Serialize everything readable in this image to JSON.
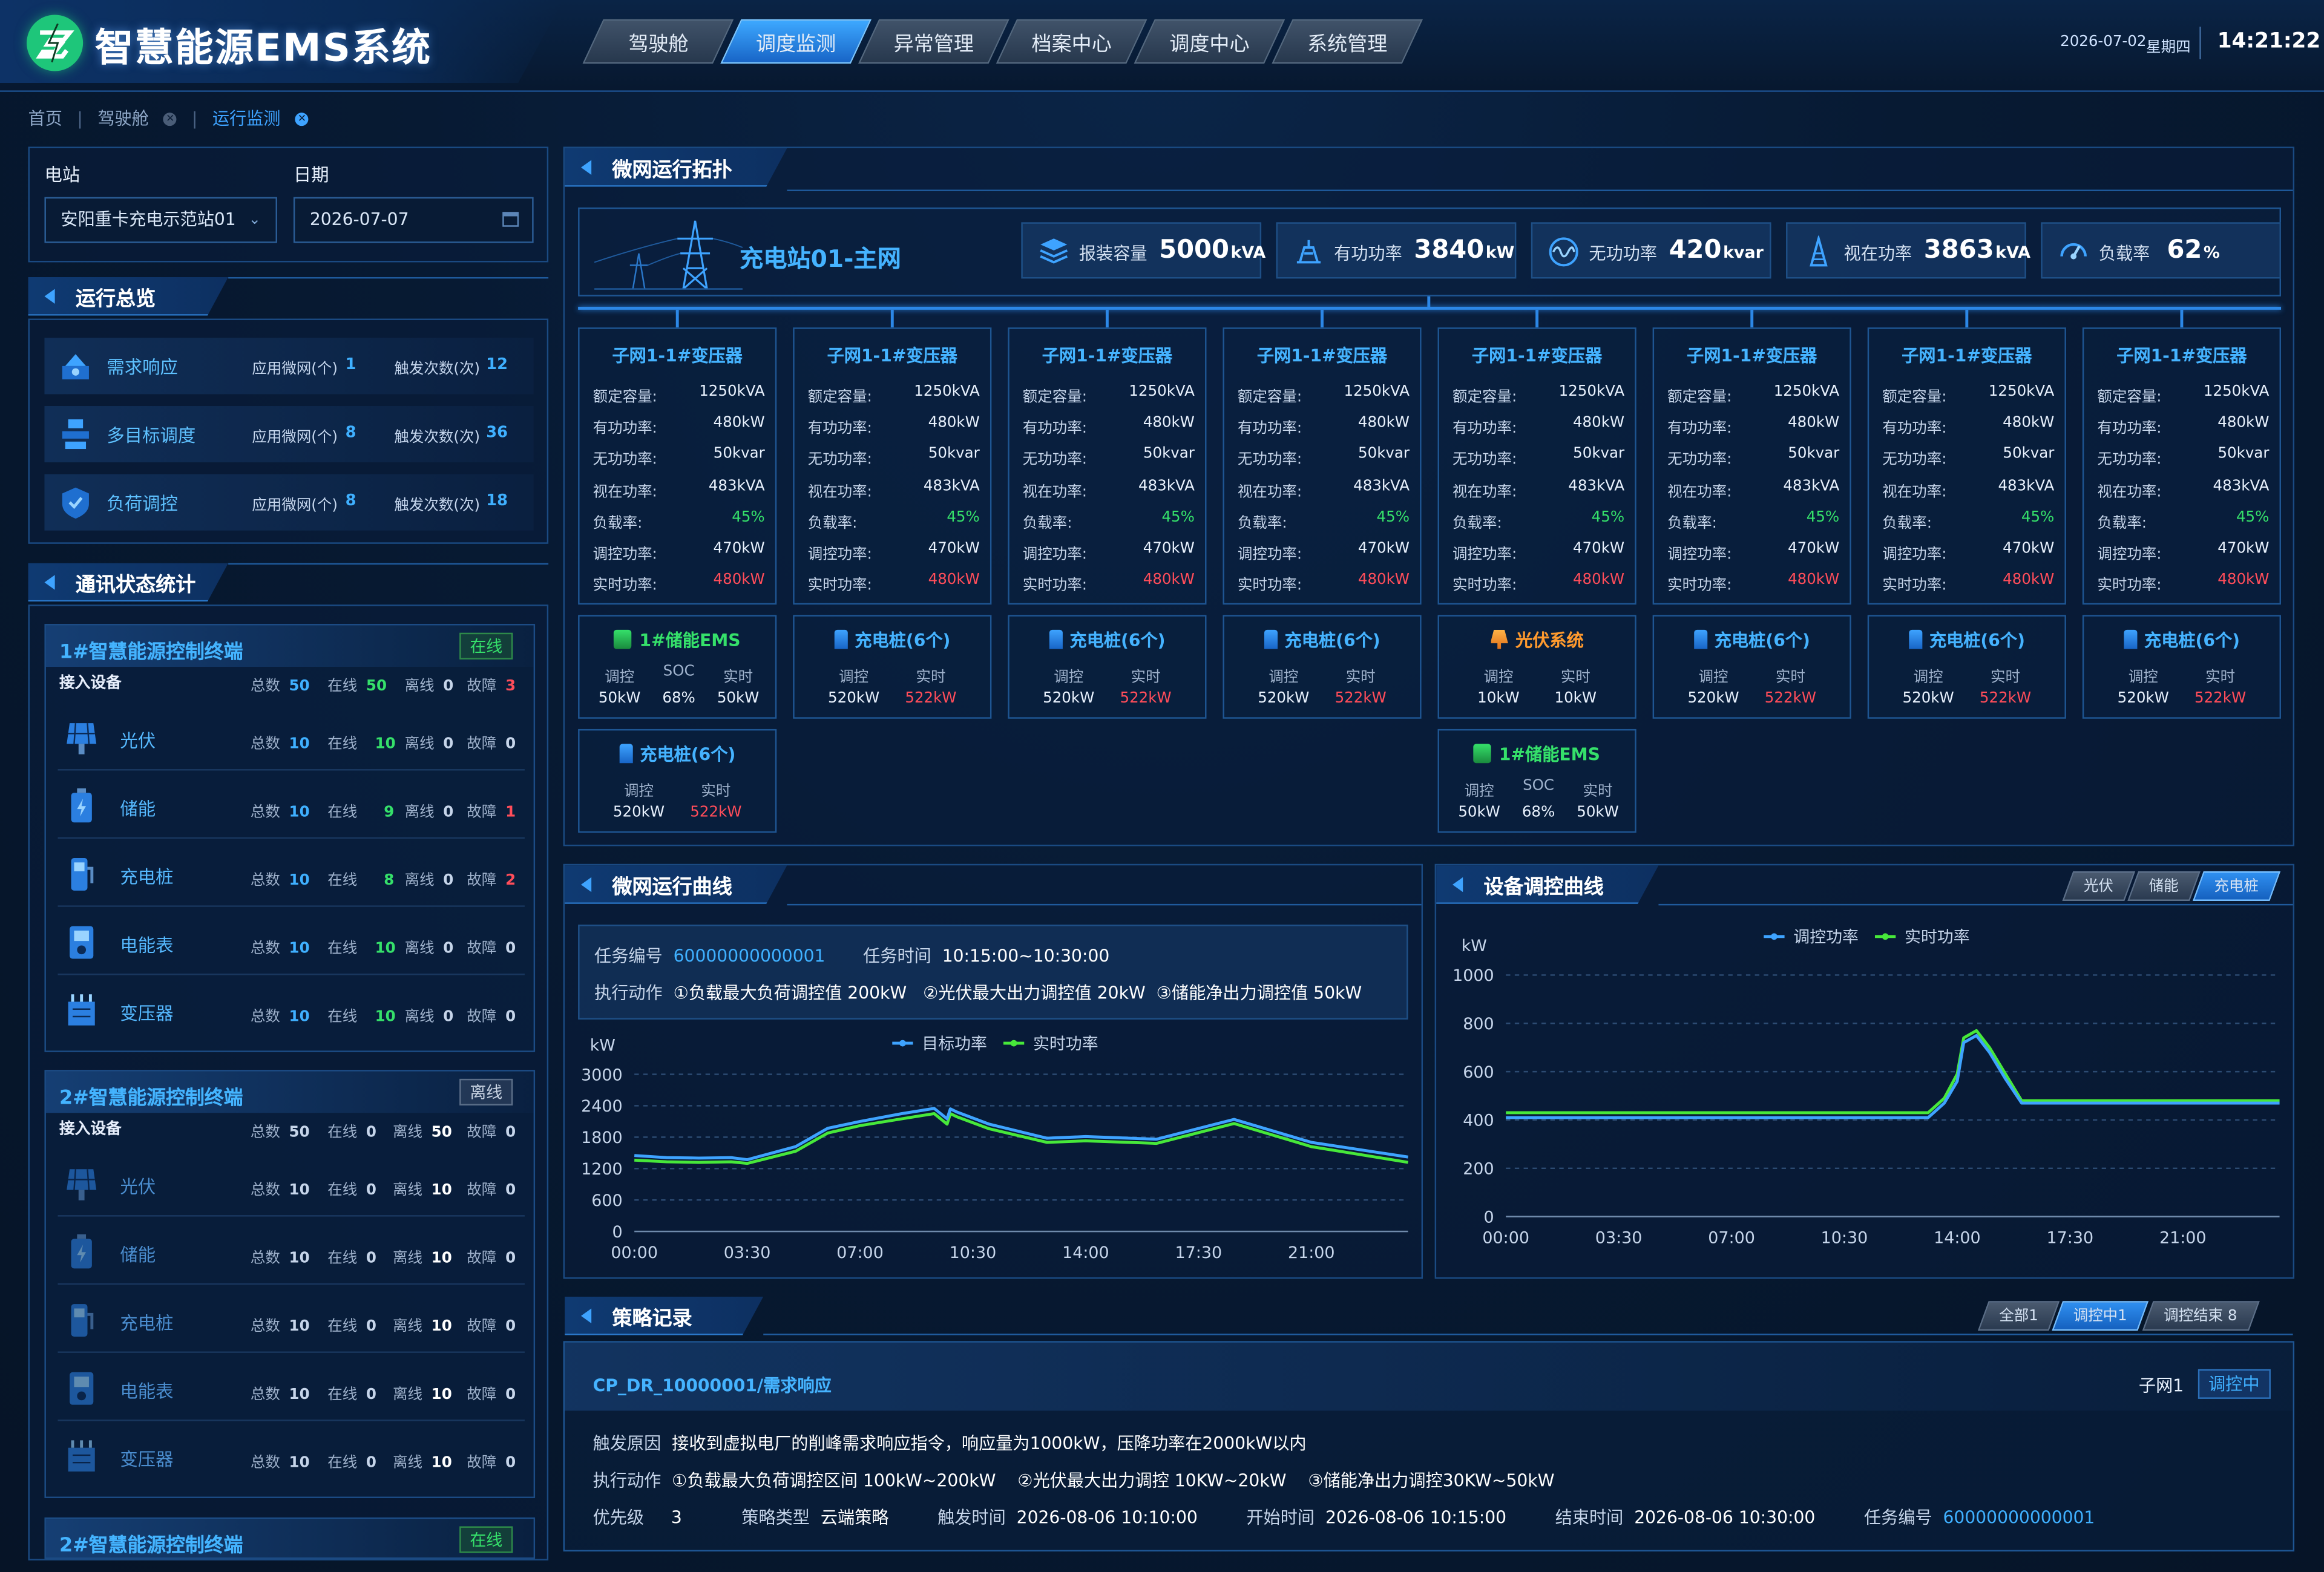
{
  "header": {
    "title": "智慧能源EMS系统",
    "nav": [
      "驾驶舱",
      "调度监测",
      "异常管理",
      "档案中心",
      "调度中心",
      "系统管理"
    ],
    "active_nav": "调度监测",
    "date": "2026-07-02",
    "weekday": "星期四",
    "time": "14:21:22"
  },
  "breadcrumb": [
    "首页",
    "驾驶舱",
    "运行监测"
  ],
  "filter": {
    "station_label": "电站",
    "station_value": "安阳重卡充电示范站01",
    "date_label": "日期",
    "date_value": "2026-07-07"
  },
  "overview": {
    "title": "运行总览",
    "col1_label": "应用微网(个)",
    "col2_label": "触发次数(次)",
    "items": [
      {
        "name": "需求响应",
        "grids": "1",
        "triggers": "12",
        "icon": "demand-response-icon"
      },
      {
        "name": "多目标调度",
        "grids": "8",
        "triggers": "36",
        "icon": "multi-objective-icon"
      },
      {
        "name": "负荷调控",
        "grids": "8",
        "triggers": "18",
        "icon": "load-control-icon"
      }
    ]
  },
  "comm": {
    "title": "通讯状态统计",
    "labels": {
      "total": "总数",
      "online": "在线",
      "offline": "离线",
      "fault": "故障",
      "access": "接入设备"
    },
    "terminals": [
      {
        "name": "1#智慧能源控制终端",
        "status": "在线",
        "summary": {
          "total": "50",
          "online": "50",
          "offline": "0",
          "fault": "3"
        },
        "devices": [
          {
            "name": "光伏",
            "total": "10",
            "online": "10",
            "offline": "0",
            "fault": "0",
            "icon": "solar-panel-icon"
          },
          {
            "name": "储能",
            "total": "10",
            "online": "9",
            "offline": "0",
            "fault": "1",
            "icon": "battery-icon"
          },
          {
            "name": "充电桩",
            "total": "10",
            "online": "8",
            "offline": "0",
            "fault": "2",
            "icon": "charger-icon"
          },
          {
            "name": "电能表",
            "total": "10",
            "online": "10",
            "offline": "0",
            "fault": "0",
            "icon": "meter-icon"
          },
          {
            "name": "变压器",
            "total": "10",
            "online": "10",
            "offline": "0",
            "fault": "0",
            "icon": "transformer-icon"
          }
        ]
      },
      {
        "name": "2#智慧能源控制终端",
        "status": "离线",
        "summary": {
          "total": "50",
          "online": "0",
          "offline": "50",
          "fault": "0"
        },
        "devices": [
          {
            "name": "光伏",
            "total": "10",
            "online": "0",
            "offline": "10",
            "fault": "0",
            "icon": "solar-panel-icon"
          },
          {
            "name": "储能",
            "total": "10",
            "online": "0",
            "offline": "10",
            "fault": "0",
            "icon": "battery-icon"
          },
          {
            "name": "充电桩",
            "total": "10",
            "online": "0",
            "offline": "10",
            "fault": "0",
            "icon": "charger-icon"
          },
          {
            "name": "电能表",
            "total": "10",
            "online": "0",
            "offline": "10",
            "fault": "0",
            "icon": "meter-icon"
          },
          {
            "name": "变压器",
            "total": "10",
            "online": "0",
            "offline": "10",
            "fault": "0",
            "icon": "transformer-icon"
          }
        ]
      },
      {
        "name": "2#智慧能源控制终端",
        "status": "在线"
      }
    ]
  },
  "topology": {
    "title": "微网运行拓扑",
    "main_grid": "充电站01-主网",
    "kpis": [
      {
        "label": "报装容量",
        "value": "5000",
        "unit": "kVA",
        "icon": "capacity-icon"
      },
      {
        "label": "有功功率",
        "value": "3840",
        "unit": "kW",
        "icon": "active-power-icon"
      },
      {
        "label": "无功功率",
        "value": "420",
        "unit": "kvar",
        "icon": "reactive-power-icon"
      },
      {
        "label": "视在功率",
        "value": "3863",
        "unit": "kVA",
        "icon": "apparent-power-icon"
      },
      {
        "label": "负载率",
        "value": "62",
        "unit": "%",
        "icon": "load-rate-icon"
      }
    ],
    "sub_labels": [
      "额定容量:",
      "有功功率:",
      "无功功率:",
      "视在功率:",
      "负载率:",
      "调控功率:",
      "实时功率:"
    ],
    "subgrids": [
      {
        "name": "子网1-1#变压器",
        "values": [
          "1250kVA",
          "480kW",
          "50kvar",
          "483kVA",
          "45%",
          "470kW",
          "480kW"
        ]
      },
      {
        "name": "子网1-1#变压器",
        "values": [
          "1250kVA",
          "480kW",
          "50kvar",
          "483kVA",
          "45%",
          "470kW",
          "480kW"
        ]
      },
      {
        "name": "子网1-1#变压器",
        "values": [
          "1250kVA",
          "480kW",
          "50kvar",
          "483kVA",
          "45%",
          "470kW",
          "480kW"
        ]
      },
      {
        "name": "子网1-1#变压器",
        "values": [
          "1250kVA",
          "480kW",
          "50kvar",
          "483kVA",
          "45%",
          "470kW",
          "480kW"
        ]
      },
      {
        "name": "子网1-1#变压器",
        "values": [
          "1250kVA",
          "480kW",
          "50kvar",
          "483kVA",
          "45%",
          "470kW",
          "480kW"
        ]
      },
      {
        "name": "子网1-1#变压器",
        "values": [
          "1250kVA",
          "480kW",
          "50kvar",
          "483kVA",
          "45%",
          "470kW",
          "480kW"
        ]
      },
      {
        "name": "子网1-1#变压器",
        "values": [
          "1250kVA",
          "480kW",
          "50kvar",
          "483kVA",
          "45%",
          "470kW",
          "480kW"
        ]
      },
      {
        "name": "子网1-1#变压器",
        "values": [
          "1250kVA",
          "480kW",
          "50kvar",
          "483kVA",
          "45%",
          "470kW",
          "480kW"
        ]
      }
    ],
    "devices_row1": [
      {
        "name": "1#储能EMS",
        "kind": "ems",
        "cols": [
          "调控",
          "SOC",
          "实时"
        ],
        "vals": [
          "50kW",
          "68%",
          "50kW"
        ]
      },
      {
        "name": "充电桩(6个)",
        "kind": "charger",
        "cols": [
          "调控",
          "实时"
        ],
        "vals": [
          "520kW",
          "522kW"
        ]
      },
      {
        "name": "充电桩(6个)",
        "kind": "charger",
        "cols": [
          "调控",
          "实时"
        ],
        "vals": [
          "520kW",
          "522kW"
        ]
      },
      {
        "name": "充电桩(6个)",
        "kind": "charger",
        "cols": [
          "调控",
          "实时"
        ],
        "vals": [
          "520kW",
          "522kW"
        ]
      },
      {
        "name": "光伏系统",
        "kind": "pv",
        "cols": [
          "调控",
          "实时"
        ],
        "vals": [
          "10kW",
          "10kW"
        ]
      },
      {
        "name": "充电桩(6个)",
        "kind": "charger",
        "cols": [
          "调控",
          "实时"
        ],
        "vals": [
          "520kW",
          "522kW"
        ]
      },
      {
        "name": "充电桩(6个)",
        "kind": "charger",
        "cols": [
          "调控",
          "实时"
        ],
        "vals": [
          "520kW",
          "522kW"
        ]
      },
      {
        "name": "充电桩(6个)",
        "kind": "charger",
        "cols": [
          "调控",
          "实时"
        ],
        "vals": [
          "520kW",
          "522kW"
        ]
      }
    ],
    "devices_row2": [
      {
        "name": "充电桩(6个)",
        "kind": "charger",
        "cols": [
          "调控",
          "实时"
        ],
        "vals": [
          "520kW",
          "522kW"
        ]
      },
      {
        "name": "1#储能EMS",
        "kind": "ems",
        "cols": [
          "调控",
          "SOC",
          "实时"
        ],
        "vals": [
          "50kW",
          "68%",
          "50kW"
        ]
      }
    ]
  },
  "micro_curve": {
    "title": "微网运行曲线",
    "task_no_label": "任务编号",
    "task_no": "60000000000001",
    "task_time_label": "任务时间",
    "task_time": "10:15:00~10:30:00",
    "action_label": "执行动作",
    "actions": [
      "①负载最大负荷调控值 200kW",
      "②光伏最大出力调控值 20kW",
      "③储能净出力调控值 50kW"
    ]
  },
  "device_curve": {
    "title": "设备调控曲线",
    "tabs": [
      "光伏",
      "储能",
      "充电桩"
    ],
    "active_tab": "充电桩"
  },
  "strategy": {
    "title": "策略记录",
    "tabs": [
      "全部1",
      "调控中1",
      "调控结束 8"
    ],
    "active_tab": "调控中1",
    "code": "CP_DR_10000001/需求响应",
    "grid": "子网1",
    "status": "调控中",
    "reason_label": "触发原因",
    "reason": "接收到虚拟电厂的削峰需求响应指令，响应量为1000kW，压降功率在2000kW以内",
    "action_label": "执行动作",
    "actions": [
      "①负载最大负荷调控区间 100kW~200kW",
      "②光伏最大出力调控 10KW~20kW",
      "③储能净出力调控30KW~50kW"
    ],
    "priority_label": "优先级",
    "priority": "3",
    "type_label": "策略类型",
    "type": "云端策略",
    "trigger_label": "触发时间",
    "trigger": "2026-08-06 10:10:00",
    "start_label": "开始时间",
    "start": "2026-08-06 10:15:00",
    "end_label": "结束时间",
    "end": "2026-08-06 10:30:00",
    "task_label": "任务编号",
    "task": "60000000000001"
  },
  "chart_data": [
    {
      "type": "line",
      "ylabel": "kW",
      "ylim": [
        0,
        3000
      ],
      "yticks": [
        "3000",
        "2400",
        "1800",
        "1200",
        "600",
        "0"
      ],
      "xticks": [
        "00:00",
        "03:30",
        "07:00",
        "10:30",
        "14:00",
        "17:30",
        "21:00"
      ],
      "x": [
        0,
        1,
        2,
        3,
        3.5,
        5,
        6,
        7,
        8.3,
        9.3,
        9.7,
        9.8,
        10,
        11,
        12.8,
        14,
        16.2,
        18.6,
        21,
        24
      ],
      "legend": "top-center",
      "series": [
        {
          "name": "目标功率",
          "color": "#3ea3ff",
          "values": [
            1450,
            1410,
            1400,
            1410,
            1370,
            1620,
            1970,
            2100,
            2250,
            2350,
            2150,
            2340,
            2280,
            2050,
            1780,
            1810,
            1760,
            2140,
            1700,
            1420
          ]
        },
        {
          "name": "实时功率",
          "color": "#47e83a",
          "values": [
            1360,
            1330,
            1320,
            1330,
            1300,
            1530,
            1880,
            2020,
            2150,
            2250,
            2050,
            2250,
            2190,
            1960,
            1700,
            1730,
            1680,
            2060,
            1620,
            1320
          ]
        }
      ]
    },
    {
      "type": "line",
      "ylabel": "kW",
      "ylim": [
        0,
        1000
      ],
      "yticks": [
        "1000",
        "800",
        "600",
        "400",
        "200",
        "0"
      ],
      "xticks": [
        "00:00",
        "03:30",
        "07:00",
        "10:30",
        "14:00",
        "17:30",
        "21:00"
      ],
      "x": [
        0,
        13.1,
        13.6,
        14,
        14.2,
        14.6,
        15,
        15.5,
        16,
        24
      ],
      "legend": "top-center",
      "series": [
        {
          "name": "调控功率",
          "color": "#3ea3ff",
          "values": [
            410,
            410,
            470,
            560,
            720,
            750,
            680,
            570,
            470,
            470
          ]
        },
        {
          "name": "实时功率",
          "color": "#47e83a",
          "values": [
            430,
            430,
            490,
            590,
            740,
            770,
            700,
            590,
            480,
            480
          ]
        }
      ]
    }
  ]
}
